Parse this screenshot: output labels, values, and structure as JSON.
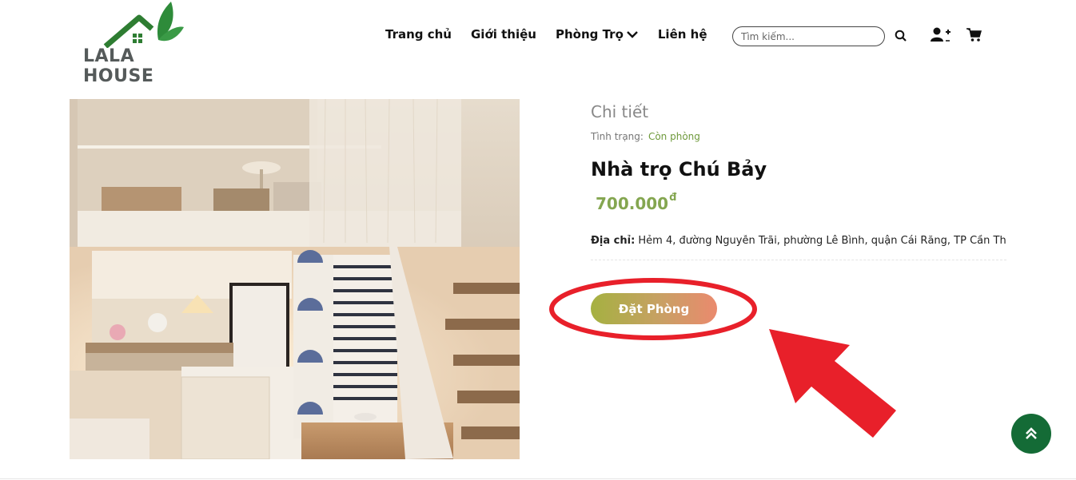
{
  "brand": {
    "logo_text": "LALA HOUSE",
    "accent_green": "#2e7d32",
    "text_gray": "#555a5a"
  },
  "nav": {
    "items": [
      {
        "label": "Trang chủ",
        "has_dropdown": false
      },
      {
        "label": "Giới thiệu",
        "has_dropdown": false
      },
      {
        "label": "Phòng Trọ",
        "has_dropdown": true
      },
      {
        "label": "Liên hệ",
        "has_dropdown": false
      }
    ]
  },
  "search": {
    "placeholder": "Tìm kiếm...",
    "value": "",
    "icon": "search-icon"
  },
  "header_icons": [
    "user-plus-icon",
    "cart-icon"
  ],
  "detail": {
    "heading": "Chi tiết",
    "status_label": "Tình trạng:",
    "status_value": "Còn phòng",
    "title": "Nhà trọ Chú Bảy",
    "price": "700.000",
    "price_currency": "đ",
    "address_label": "Địa chỉ:",
    "address_value": "Hẻm 4, đường Nguyễn Trãi, phường Lê Bình, quận Cái Răng, TP Cần Thơ",
    "book_button": "Đặt Phòng"
  },
  "colors": {
    "price": "#84a650",
    "status": "#6f9a3c",
    "button_gradient": [
      "#a5b141",
      "#ea8a6e"
    ],
    "annotation_red": "#e8202a",
    "scroll_top_bg": "#146b36"
  }
}
